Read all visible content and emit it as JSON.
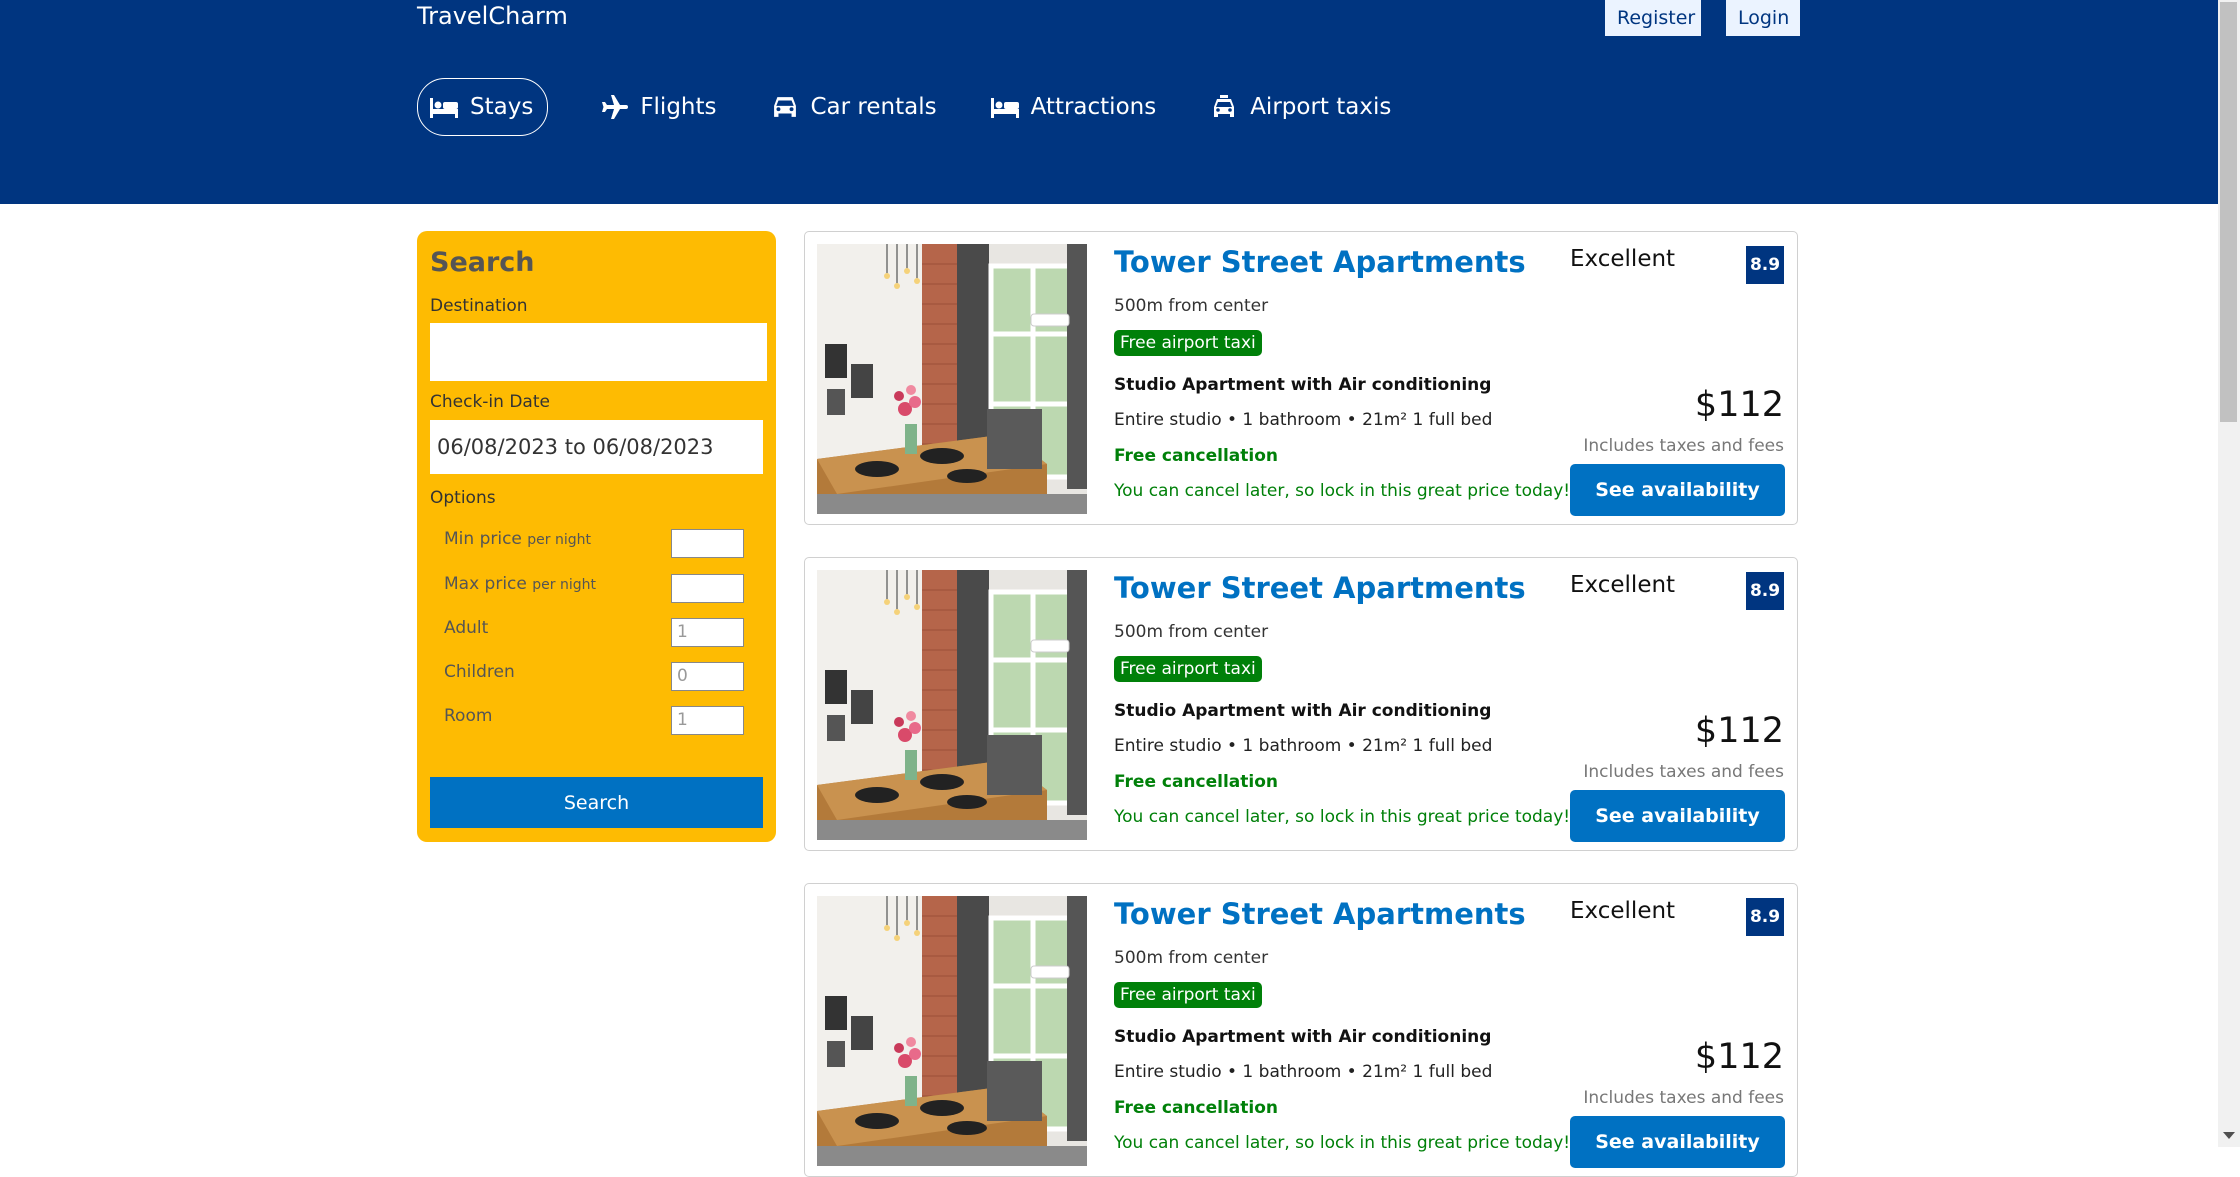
{
  "header": {
    "logo": "TravelCharm",
    "register_label": "Register",
    "login_label": "Login",
    "nav": [
      {
        "label": "Stays",
        "icon": "bed-icon",
        "active": true
      },
      {
        "label": "Flights",
        "icon": "plane-icon"
      },
      {
        "label": "Car rentals",
        "icon": "car-icon"
      },
      {
        "label": "Attractions",
        "icon": "bed-icon"
      },
      {
        "label": "Airport taxis",
        "icon": "taxi-icon"
      }
    ]
  },
  "search": {
    "title": "Search",
    "destination_label": "Destination",
    "destination_value": "",
    "checkin_label": "Check-in Date",
    "checkin_value": "06/08/2023 to 06/08/2023",
    "options_label": "Options",
    "options": [
      {
        "label": "Min price",
        "suffix": "per night",
        "placeholder": ""
      },
      {
        "label": "Max price",
        "suffix": "per night",
        "placeholder": ""
      },
      {
        "label": "Adult",
        "placeholder": "1"
      },
      {
        "label": "Children",
        "placeholder": "0"
      },
      {
        "label": "Room",
        "placeholder": "1"
      }
    ],
    "button_label": "Search"
  },
  "results": [
    {
      "name": "Tower Street Apartments",
      "distance": "500m from center",
      "taxi": "Free airport taxi",
      "room": "Studio Apartment with Air conditioning",
      "features": "Entire studio • 1 bathroom • 21m² 1 full bed",
      "cancel": "Free cancellation",
      "cancel_sub": "You can cancel later, so lock in this great price today!",
      "rating_text": "Excellent",
      "rating": "8.9",
      "price": "$112",
      "taxes": "Includes taxes and fees",
      "button": "See availability"
    },
    {
      "name": "Tower Street Apartments",
      "distance": "500m from center",
      "taxi": "Free airport taxi",
      "room": "Studio Apartment with Air conditioning",
      "features": "Entire studio • 1 bathroom • 21m² 1 full bed",
      "cancel": "Free cancellation",
      "cancel_sub": "You can cancel later, so lock in this great price today!",
      "rating_text": "Excellent",
      "rating": "8.9",
      "price": "$112",
      "taxes": "Includes taxes and fees",
      "button": "See availability"
    },
    {
      "name": "Tower Street Apartments",
      "distance": "500m from center",
      "taxi": "Free airport taxi",
      "room": "Studio Apartment with Air conditioning",
      "features": "Entire studio • 1 bathroom • 21m² 1 full bed",
      "cancel": "Free cancellation",
      "cancel_sub": "You can cancel later, so lock in this great price today!",
      "rating_text": "Excellent",
      "rating": "8.9",
      "price": "$112",
      "taxes": "Includes taxes and fees",
      "button": "See availability"
    }
  ],
  "colors": {
    "header_bg": "#003580",
    "search_bg": "#febb02",
    "primary": "#0071c2",
    "green": "#008009"
  }
}
